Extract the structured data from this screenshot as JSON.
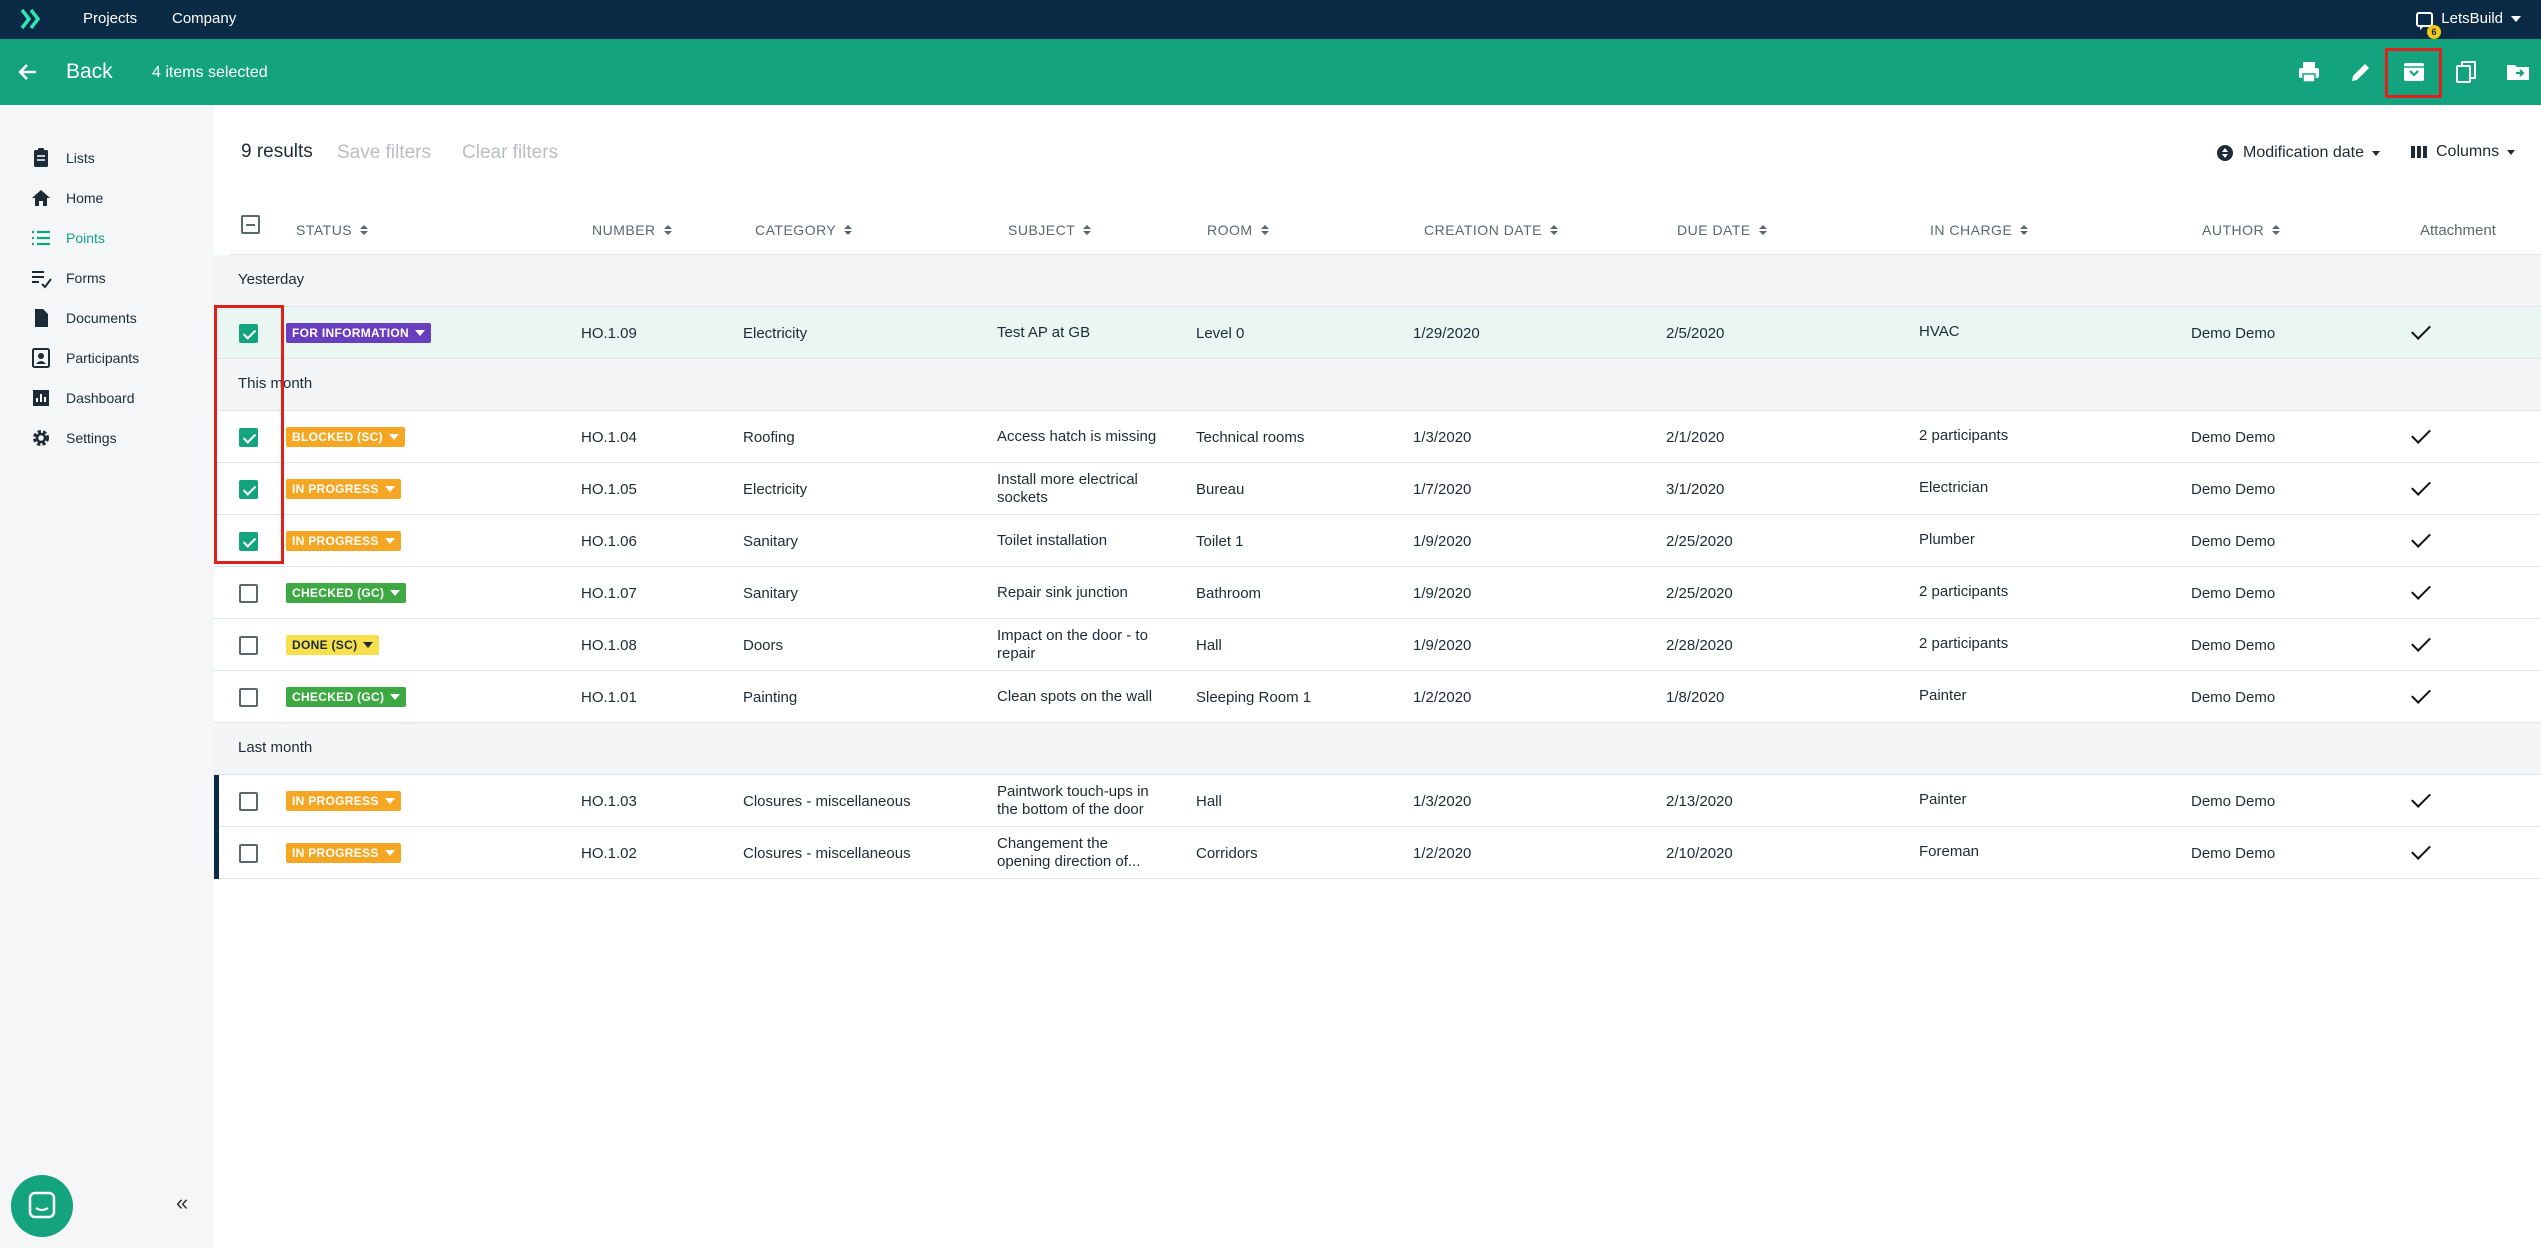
{
  "topbar": {
    "nav": [
      "Projects",
      "Company"
    ],
    "user": "LetsBuild",
    "notification_count": "6"
  },
  "actionbar": {
    "back_label": "Back",
    "selected_label": "4 items selected",
    "actions": [
      "print-icon",
      "edit-icon",
      "archive-icon",
      "copy-icon",
      "move-folder-icon"
    ]
  },
  "sidebar": {
    "items": [
      {
        "label": "Lists",
        "icon": "clipboard-icon"
      },
      {
        "label": "Home",
        "icon": "home-icon"
      },
      {
        "label": "Points",
        "icon": "list-icon"
      },
      {
        "label": "Forms",
        "icon": "forms-icon"
      },
      {
        "label": "Documents",
        "icon": "document-icon"
      },
      {
        "label": "Participants",
        "icon": "participants-icon"
      },
      {
        "label": "Dashboard",
        "icon": "dashboard-icon"
      },
      {
        "label": "Settings",
        "icon": "gear-icon"
      }
    ]
  },
  "toolbar": {
    "results": "9 results",
    "save_filters": "Save filters",
    "clear_filters": "Clear filters",
    "sort_label": "Modification date",
    "columns_label": "Columns"
  },
  "columns": [
    "STATUS",
    "NUMBER",
    "CATEGORY",
    "SUBJECT",
    "ROOM",
    "CREATION DATE",
    "DUE DATE",
    "IN CHARGE",
    "AUTHOR",
    "Attachment"
  ],
  "groups": [
    {
      "label": "Yesterday",
      "rows": [
        {
          "checked": true,
          "status": "FOR INFORMATION",
          "status_color": "#6a3fbf",
          "number": "HO.1.09",
          "category": "Electricity",
          "subject": "Test AP at GB",
          "room": "Level 0",
          "created": "1/29/2020",
          "due": "2/5/2020",
          "in_charge": "HVAC",
          "author": "Demo Demo",
          "attachment": true
        }
      ]
    },
    {
      "label": "This month",
      "rows": [
        {
          "checked": true,
          "status": "BLOCKED (SC)",
          "status_color": "#f5a623",
          "number": "HO.1.04",
          "category": "Roofing",
          "subject": "Access hatch is missing",
          "room": "Technical rooms",
          "created": "1/3/2020",
          "due": "2/1/2020",
          "in_charge": "2 participants",
          "author": "Demo Demo",
          "attachment": true
        },
        {
          "checked": true,
          "status": "IN PROGRESS",
          "status_color": "#f5a623",
          "number": "HO.1.05",
          "category": "Electricity",
          "subject": "Install more electrical sockets",
          "room": "Bureau",
          "created": "1/7/2020",
          "due": "3/1/2020",
          "in_charge": "Electrician",
          "author": "Demo Demo",
          "attachment": true
        },
        {
          "checked": true,
          "status": "IN PROGRESS",
          "status_color": "#f5a623",
          "number": "HO.1.06",
          "category": "Sanitary",
          "subject": "Toilet installation",
          "room": "Toilet 1",
          "created": "1/9/2020",
          "due": "2/25/2020",
          "in_charge": "Plumber",
          "author": "Demo Demo",
          "attachment": true
        },
        {
          "checked": false,
          "status": "CHECKED (GC)",
          "status_color": "#3ea843",
          "number": "HO.1.07",
          "category": "Sanitary",
          "subject": "Repair sink junction",
          "room": "Bathroom",
          "created": "1/9/2020",
          "due": "2/25/2020",
          "in_charge": "2 participants",
          "author": "Demo Demo",
          "attachment": true
        },
        {
          "checked": false,
          "status": "DONE (SC)",
          "status_color": "#f7e04b",
          "number": "HO.1.08",
          "category": "Doors",
          "subject": "Impact on the door - to repair",
          "room": "Hall",
          "created": "1/9/2020",
          "due": "2/28/2020",
          "in_charge": "2 participants",
          "author": "Demo Demo",
          "attachment": true
        },
        {
          "checked": false,
          "status": "CHECKED (GC)",
          "status_color": "#3ea843",
          "number": "HO.1.01",
          "category": "Painting",
          "subject": "Clean spots on the wall",
          "room": "Sleeping Room 1",
          "created": "1/2/2020",
          "due": "1/8/2020",
          "in_charge": "Painter",
          "author": "Demo Demo",
          "attachment": true
        }
      ]
    },
    {
      "label": "Last month",
      "rows": [
        {
          "checked": false,
          "status": "IN PROGRESS",
          "status_color": "#f5a623",
          "number": "HO.1.03",
          "category": "Closures - miscellaneous",
          "subject": "Paintwork touch-ups in the bottom of the door",
          "room": "Hall",
          "created": "1/3/2020",
          "due": "2/13/2020",
          "in_charge": "Painter",
          "author": "Demo Demo",
          "attachment": true
        },
        {
          "checked": false,
          "status": "IN PROGRESS",
          "status_color": "#f5a623",
          "number": "HO.1.02",
          "category": "Closures - miscellaneous",
          "subject": "Changement the opening direction of...",
          "room": "Corridors",
          "created": "1/2/2020",
          "due": "2/10/2020",
          "in_charge": "Foreman",
          "author": "Demo Demo",
          "attachment": true
        }
      ]
    }
  ]
}
